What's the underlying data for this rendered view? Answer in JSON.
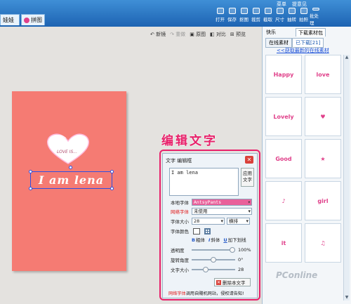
{
  "top": {
    "tabs": [
      "娃娃",
      "拼图"
    ],
    "window": [
      "菜单",
      "提意见"
    ],
    "tools": [
      "打开",
      "保存",
      "抠图",
      "裁剪",
      "截取",
      "尺寸",
      "抽转",
      "拍照",
      "批处理"
    ]
  },
  "edit_toolbar": {
    "new": "新镜",
    "redo": "重做",
    "original": "原图",
    "compare": "对比",
    "preview": "预览"
  },
  "canvas": {
    "love_text": "LOVE IS...",
    "main_text": "I am lena",
    "bg_color": "#f57b73"
  },
  "callout": "编辑文字",
  "dialog": {
    "title": "文字 编辑框",
    "close": "✕",
    "text_value": "I am lena",
    "apply": "应用文字",
    "local_font_label": "本地字体",
    "local_font_value": "AntsyPants",
    "net_font_label": "网络字体",
    "net_font_value": "未使用",
    "font_size_label": "字体大小",
    "font_size_value": "28",
    "layout_value": "横排",
    "font_color_label": "字体颜色",
    "bold": "粗体",
    "italic": "斜体",
    "underline": "加下划线",
    "opacity_label": "透明度",
    "opacity_value": "100%",
    "rotation_label": "旋转角度",
    "rotation_value": "0°",
    "size_label": "文字大小",
    "size_value": "28",
    "delete": "删除本文字",
    "footnote_red": "网络字体",
    "footnote_rest": "调用自賤机网站，侵权请告知!",
    "sliders": {
      "opacity": 1.0,
      "rotation": 0.5,
      "size": 0.3
    }
  },
  "panel": {
    "tabs": [
      "快乐",
      "下载素材包"
    ],
    "subtabs": [
      "在线素材",
      "已下载[21]"
    ],
    "link": "<<获取最新的在线素材",
    "thumbs": [
      "Happy",
      "love",
      "Lovely",
      "♥",
      "Good",
      "★",
      "♪",
      "girl",
      "it",
      "♫"
    ]
  },
  "watermark": "PConline"
}
